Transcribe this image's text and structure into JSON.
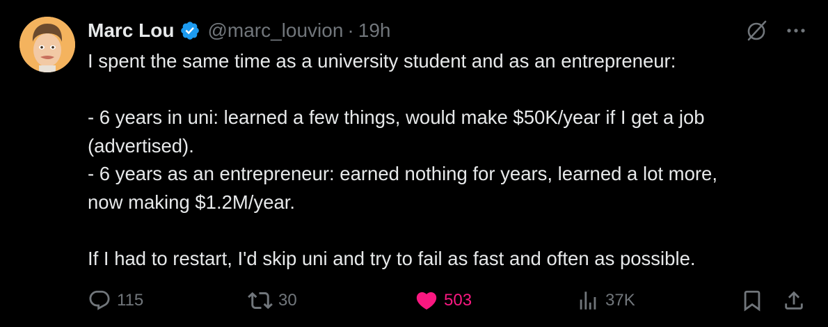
{
  "author": {
    "display_name": "Marc Lou",
    "handle": "@marc_louvion",
    "separator": "·",
    "time": "19h",
    "verified": true,
    "avatar": "avatar-photo"
  },
  "tweet": {
    "lines": [
      "I spent the same time as a university student and as an entrepreneur:",
      "",
      "- 6 years in uni: learned a few things, would make $50K/year if I get a job",
      "(advertised).",
      "- 6 years as an entrepreneur: earned nothing for years, learned a lot more,",
      "now making $1.2M/year.",
      "",
      "If I had to restart, I'd skip uni and try to fail as fast and often as possible."
    ]
  },
  "actions": {
    "replies": "115",
    "retweets": "30",
    "likes": "503",
    "views": "37K"
  },
  "icons": {
    "reply": "reply-bubble-icon",
    "retweet": "retweet-icon",
    "like": "heart-icon",
    "views": "views-bar-chart-icon",
    "bookmark": "bookmark-icon",
    "share": "share-icon",
    "grok": "grok-icon",
    "more": "more-dots-icon",
    "verified": "verified-badge-icon"
  },
  "colors": {
    "background": "#000000",
    "text": "#e7e9ea",
    "secondary": "#71767b",
    "like_active": "#f91880",
    "verified": "#1d9bf0"
  }
}
